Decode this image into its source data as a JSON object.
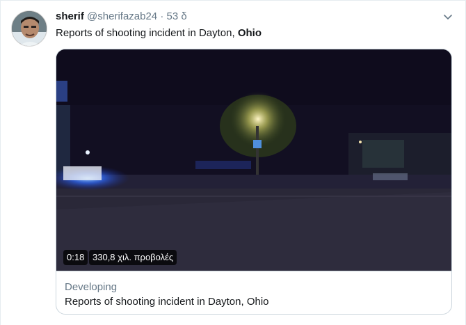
{
  "tweet": {
    "author_name": "sherif",
    "author_handle": "@sherifazab24",
    "separator": "·",
    "timestamp": "53 δ",
    "text_prefix": "Reports of shooting incident in Dayton, ",
    "text_bold": "Ohio"
  },
  "video": {
    "duration": "0:18",
    "views": "330,8 χιλ. προβολές"
  },
  "card": {
    "label": "Developing",
    "title": "Reports of shooting incident in Dayton, Ohio"
  },
  "colors": {
    "secondary_text": "#657786",
    "border": "#ccd6dd"
  },
  "icons": {
    "caret": "chevron-down-icon",
    "avatar": "avatar"
  }
}
